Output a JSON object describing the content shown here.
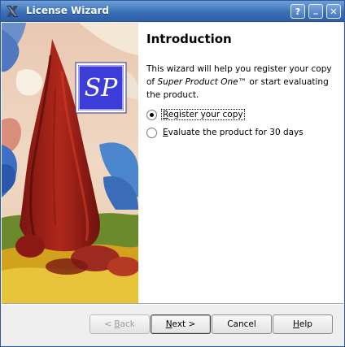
{
  "window": {
    "title": "License Wizard",
    "controls": {
      "help": "?",
      "minimize": "_",
      "close": "✕"
    }
  },
  "side_image": {
    "logo_text": "SP"
  },
  "page": {
    "heading": "Introduction",
    "intro_before": "This wizard will help you register your copy of ",
    "intro_product": "Super Product One™",
    "intro_after": " or start evaluating the product.",
    "options": [
      {
        "label_mnemonic": "R",
        "label_rest": "egister your copy",
        "selected": true
      },
      {
        "label_mnemonic": "E",
        "label_rest": "valuate the product for 30 days",
        "selected": false
      }
    ]
  },
  "buttons": {
    "back": {
      "prefix": "< ",
      "mnemonic": "B",
      "rest": "ack",
      "enabled": false
    },
    "next": {
      "mnemonic": "N",
      "rest": "ext >",
      "enabled": true
    },
    "cancel": {
      "label": "Cancel"
    },
    "help": {
      "mnemonic": "H",
      "rest": "elp"
    }
  }
}
